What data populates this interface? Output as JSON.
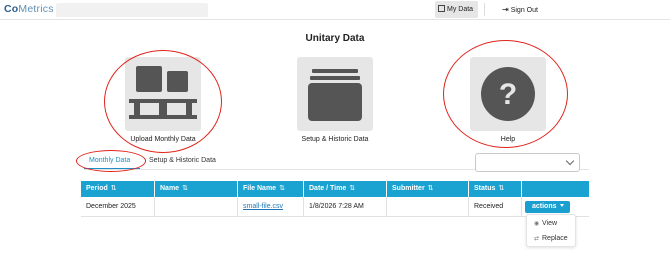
{
  "app": {
    "logo_prefix": "Co",
    "logo_rest": "Metrics"
  },
  "nav": {
    "my_data": "My Data",
    "sign_out": "Sign Out"
  },
  "page": {
    "title": "Unitary Data"
  },
  "tiles": [
    {
      "label": "Upload Monthly Data",
      "icon": "upload-grid-icon"
    },
    {
      "label": "Setup & Historic Data",
      "icon": "folder-stack-icon"
    },
    {
      "label": "Help",
      "icon": "question-circle-icon"
    }
  ],
  "tabs": [
    {
      "label": "Monthly Data",
      "active": true
    },
    {
      "label": "Setup & Historic Data",
      "active": false
    }
  ],
  "filter_select": {
    "value": ""
  },
  "table": {
    "columns": [
      "Period",
      "Name",
      "File Name",
      "Date / Time",
      "Submitter",
      "Status",
      ""
    ],
    "sort_glyph": "⇅",
    "rows": [
      {
        "period": "December 2025",
        "name": "",
        "file_name": "small-file.csv",
        "date_time": "1/8/2026 7:28 AM",
        "submitter": "",
        "status": "Received",
        "action_label": "actions"
      }
    ]
  },
  "actions_menu": {
    "items": [
      {
        "label": "View",
        "icon": "eye-icon"
      },
      {
        "label": "Replace",
        "icon": "replace-icon"
      }
    ]
  },
  "colors": {
    "accent": "#1aa2d1",
    "highlight_ring": "#e0231b",
    "tile_bg": "#e6e6e6",
    "icon_dark": "#555555"
  }
}
